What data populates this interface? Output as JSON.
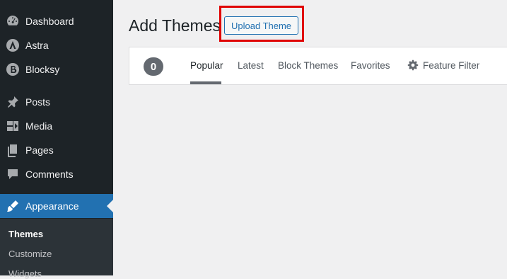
{
  "sidebar": {
    "items": [
      {
        "label": "Dashboard",
        "icon": "dashboard-icon"
      },
      {
        "label": "Astra",
        "icon": "astra-icon"
      },
      {
        "label": "Blocksy",
        "icon": "blocksy-icon"
      },
      {
        "label": "Posts",
        "icon": "pin-icon"
      },
      {
        "label": "Media",
        "icon": "media-icon"
      },
      {
        "label": "Pages",
        "icon": "pages-icon"
      },
      {
        "label": "Comments",
        "icon": "comment-icon"
      },
      {
        "label": "Appearance",
        "icon": "brush-icon"
      }
    ],
    "submenu": [
      {
        "label": "Themes"
      },
      {
        "label": "Customize"
      },
      {
        "label": "Widgets"
      }
    ]
  },
  "main": {
    "title": "Add Themes",
    "upload_button": "Upload Theme",
    "count": "0",
    "filters": [
      {
        "label": "Popular"
      },
      {
        "label": "Latest"
      },
      {
        "label": "Block Themes"
      },
      {
        "label": "Favorites"
      }
    ],
    "feature_filter": "Feature Filter"
  },
  "colors": {
    "sidebar_bg": "#1d2327",
    "active_bg": "#2271b1",
    "highlight": "#e00000"
  }
}
